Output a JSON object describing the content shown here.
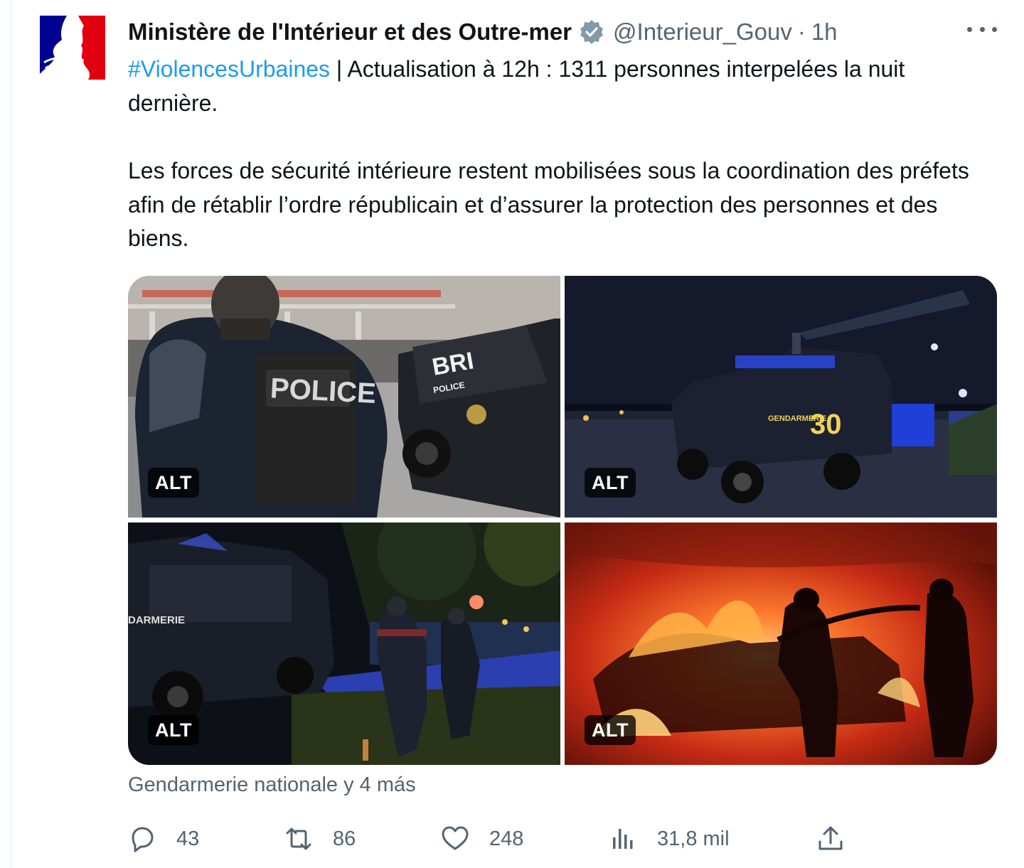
{
  "tweet": {
    "author_name": "Ministère de l'Intérieur et des Outre-mer",
    "author_handle": "@Interieur_Gouv",
    "separator": "·",
    "time": "1h",
    "hashtag": "#ViolencesUrbaines",
    "line1_rest": " | Actualisation à 12h : 1311 personnes interpelées la nuit dernière.",
    "paragraph2": "Les forces de sécurité intérieure restent mobilisées sous la coordination des préfets afin de rétablir l’ordre républicain et d’assurer la protection des personnes et des biens.",
    "tagged": "Gendarmerie nationale y 4 más"
  },
  "media": {
    "alt_badge": "ALT",
    "photos": [
      {
        "vest_text": "POLICE",
        "vehicle_text": "BRI",
        "vehicle_subtext": "POLICE",
        "icon": "police-officer-armored-vehicle-photo"
      },
      {
        "vehicle_text": "GENDARMERIE",
        "vehicle_number": "30",
        "icon": "gendarmerie-vehicle-night-photo"
      },
      {
        "vehicle_text": "DARMERIE",
        "icon": "gendarmes-night-street-photo"
      },
      {
        "icon": "firefighters-car-fire-photo"
      }
    ]
  },
  "actions": {
    "replies": "43",
    "retweets": "86",
    "likes": "248",
    "views": "31,8 mil"
  },
  "colors": {
    "link": "#1d9bf0",
    "secondary_text": "#536471",
    "verified": "#829aab",
    "flag_blue": "#000091",
    "flag_red": "#e1000f"
  }
}
